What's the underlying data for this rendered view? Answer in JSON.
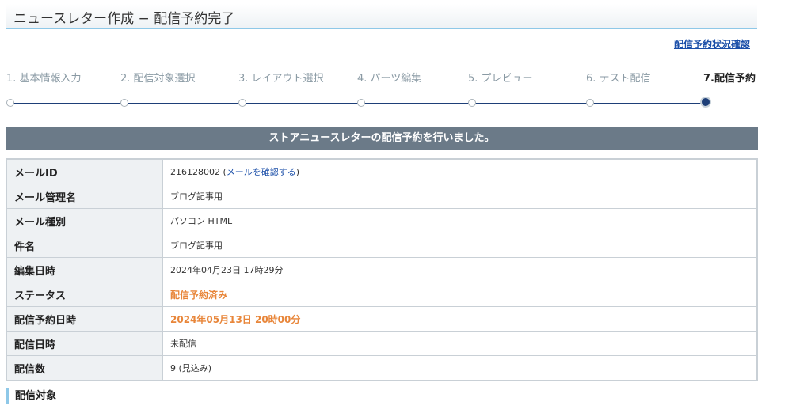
{
  "header": {
    "title": "ニュースレター作成 − 配信予約完了"
  },
  "links": {
    "status_check": "配信予約状況確認"
  },
  "steps": [
    {
      "label": "1. 基本情報入力",
      "active": false
    },
    {
      "label": "2. 配信対象選択",
      "active": false
    },
    {
      "label": "3. レイアウト選択",
      "active": false
    },
    {
      "label": "4. パーツ編集",
      "active": false
    },
    {
      "label": "5. プレビュー",
      "active": false
    },
    {
      "label": "6. テスト配信",
      "active": false
    },
    {
      "label": "7.配信予約",
      "active": true
    }
  ],
  "banner": {
    "message": "ストアニュースレターの配信予約を行いました。"
  },
  "details": {
    "mail_id": {
      "label": "メールID",
      "value": "216128002",
      "link_text": "メールを確認する"
    },
    "mail_name": {
      "label": "メール管理名",
      "value": "ブログ記事用"
    },
    "mail_type": {
      "label": "メール種別",
      "value": "パソコン HTML"
    },
    "subject": {
      "label": "件名",
      "value": "ブログ記事用"
    },
    "edited_at": {
      "label": "編集日時",
      "value": "2024年04月23日 17時29分"
    },
    "status": {
      "label": "ステータス",
      "value": "配信予約済み"
    },
    "scheduled_at": {
      "label": "配信予約日時",
      "value": "2024年05月13日 20時00分"
    },
    "sent_at": {
      "label": "配信日時",
      "value": "未配信"
    },
    "count": {
      "label": "配信数",
      "value": "9 (見込み)"
    }
  },
  "section": {
    "target_heading": "配信対象"
  },
  "colors": {
    "accent_line": "#1e3f78",
    "banner_bg": "#6b7a88",
    "status_orange": "#e8863a",
    "link_blue": "#1a4ea8"
  }
}
